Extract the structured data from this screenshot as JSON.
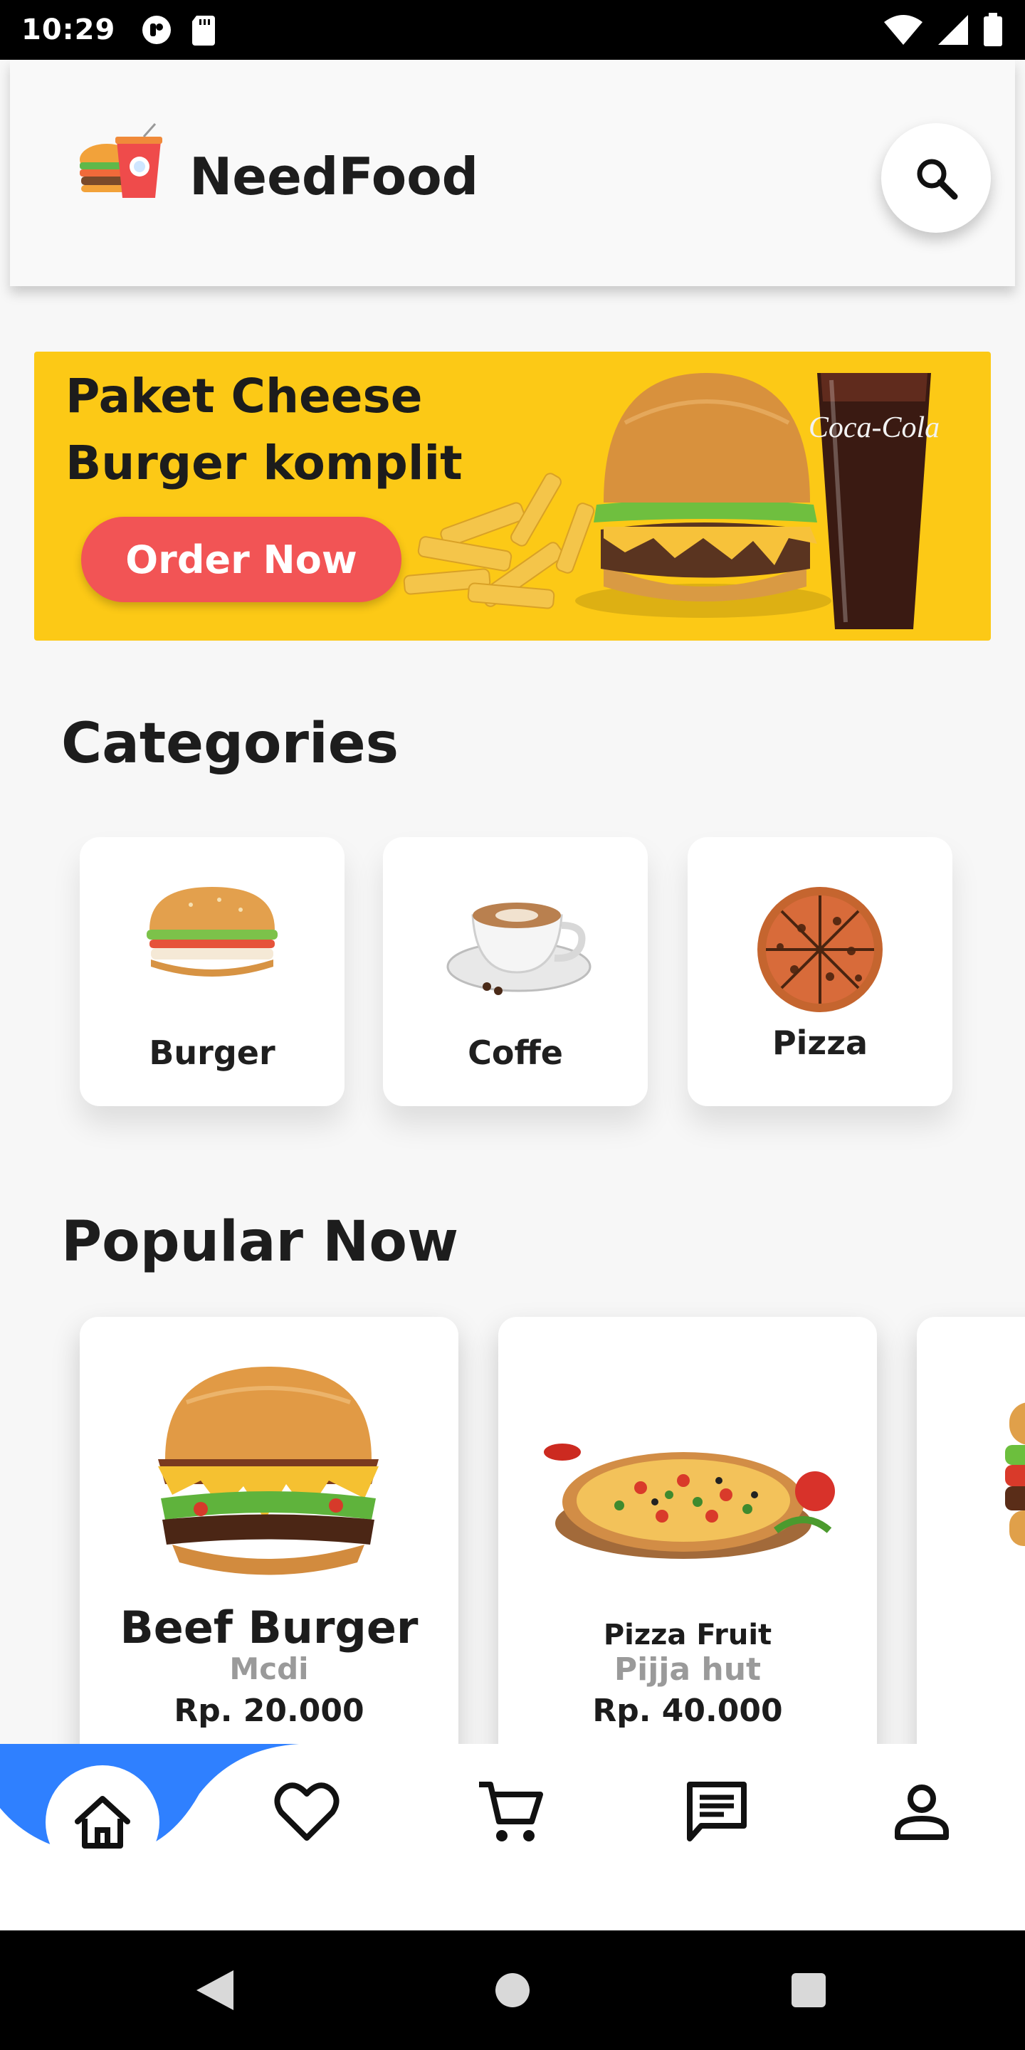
{
  "status": {
    "time": "10:29"
  },
  "header": {
    "title": "NeedFood"
  },
  "banner": {
    "title": "Paket Cheese Burger komplit",
    "cta": "Order Now",
    "brand_on_cup": "Coca-Cola"
  },
  "categories": {
    "title": "Categories",
    "items": [
      {
        "label": "Burger",
        "icon": "burger-icon"
      },
      {
        "label": "Coffe",
        "icon": "coffee-icon"
      },
      {
        "label": "Pizza",
        "icon": "pizza-icon"
      }
    ]
  },
  "popular": {
    "title": "Popular Now",
    "items": [
      {
        "name": "Beef Burger",
        "shop": "Mcdi",
        "price": "Rp. 20.000"
      },
      {
        "name": "Pizza Fruit",
        "shop": "Pijja hut",
        "price": "Rp. 40.000"
      },
      {
        "name": "",
        "shop": "",
        "price": ""
      }
    ]
  },
  "nav": {
    "items": [
      {
        "name": "home",
        "icon": "home-icon",
        "active": true
      },
      {
        "name": "favorites",
        "icon": "heart-icon",
        "active": false
      },
      {
        "name": "cart",
        "icon": "cart-icon",
        "active": false
      },
      {
        "name": "messages",
        "icon": "message-icon",
        "active": false
      },
      {
        "name": "profile",
        "icon": "person-icon",
        "active": false
      }
    ]
  },
  "colors": {
    "banner": "#fcc916",
    "accent_button": "#f25455",
    "nav_wave": "#2f80ff",
    "muted_text": "#9a9a9a"
  }
}
